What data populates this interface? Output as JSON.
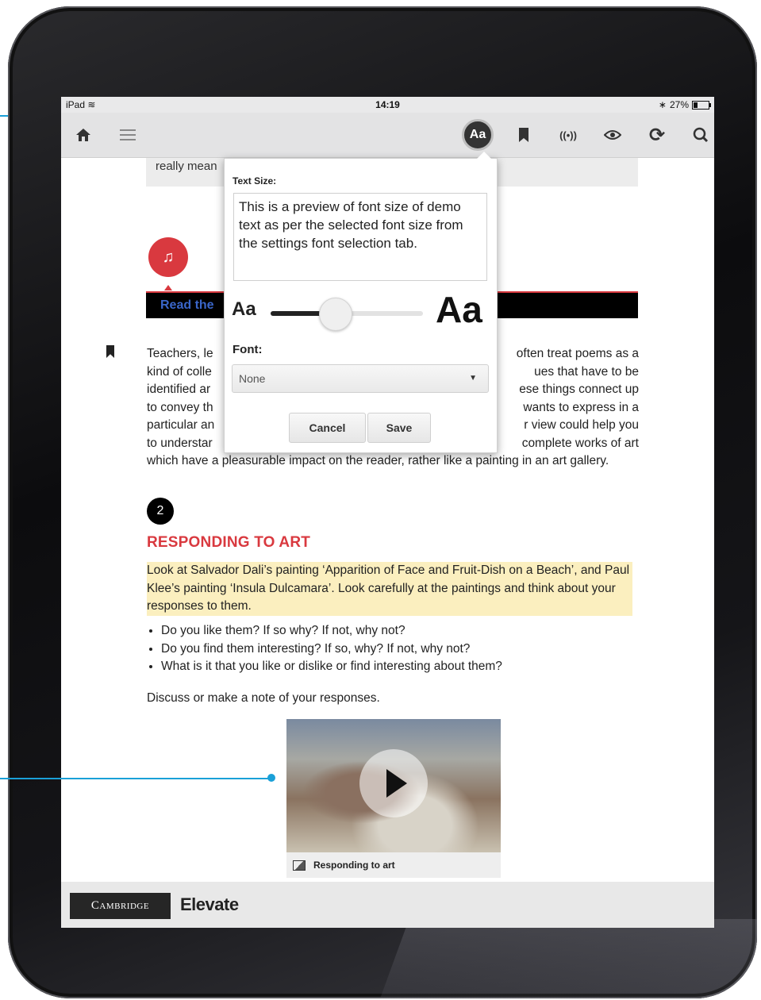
{
  "status_bar": {
    "device": "iPad",
    "time": "14:19",
    "battery": "27%"
  },
  "toolbar": {
    "font_button_label": "Aa",
    "icons": [
      "home-icon",
      "menu-icon",
      "bookmark-icon",
      "broadcast-icon",
      "eye-icon",
      "refresh-icon",
      "search-icon"
    ]
  },
  "content": {
    "note_text": "really mean",
    "read_bar_text": "Read the",
    "paragraph_lines": [
      "Teachers, le",
      "kind of colle",
      "identified ar",
      "to convey th",
      "particular an",
      "to understar"
    ],
    "paragraph_right_lines": [
      "often treat poems as a",
      "ues that have to be",
      "ese things connect up",
      "wants to express in a",
      "r view could help you",
      "complete works of art"
    ],
    "paragraph_tail": "which have a pleasurable impact on the reader, rather like a painting in an art gallery.",
    "step_number": "2",
    "section_heading": "RESPONDING TO ART",
    "highlight_text": "Look at Salvador Dali’s painting ‘Apparition of Face and Fruit-Dish on a Beach’, and Paul Klee’s painting ‘Insula Dulcamara’. Look carefully at the paintings and think about your responses to them.",
    "bullets": [
      "Do you like them? If so why? If not, why not?",
      "Do you find them interesting? If so, why? If not, why not?",
      "What is it that you like or dislike or find interesting about them?"
    ],
    "discuss_text": "Discuss or make a note of your responses.",
    "video_caption": "Responding to art"
  },
  "popup": {
    "text_size_label": "Text Size:",
    "preview_text": "This is a preview of font size of demo text as per the selected font size from the settings font selection tab.",
    "small_aa": "Aa",
    "large_aa": "Aa",
    "slider_value": 0.42,
    "font_label": "Font:",
    "font_selected": "None",
    "cancel_label": "Cancel",
    "save_label": "Save"
  },
  "footer": {
    "cambridge_label": "Cambridge",
    "elevate_label": "Elevate"
  },
  "colors": {
    "accent_red": "#d9393f",
    "callout_blue": "#1aa0d8",
    "highlight_yellow": "#fbefbf"
  }
}
